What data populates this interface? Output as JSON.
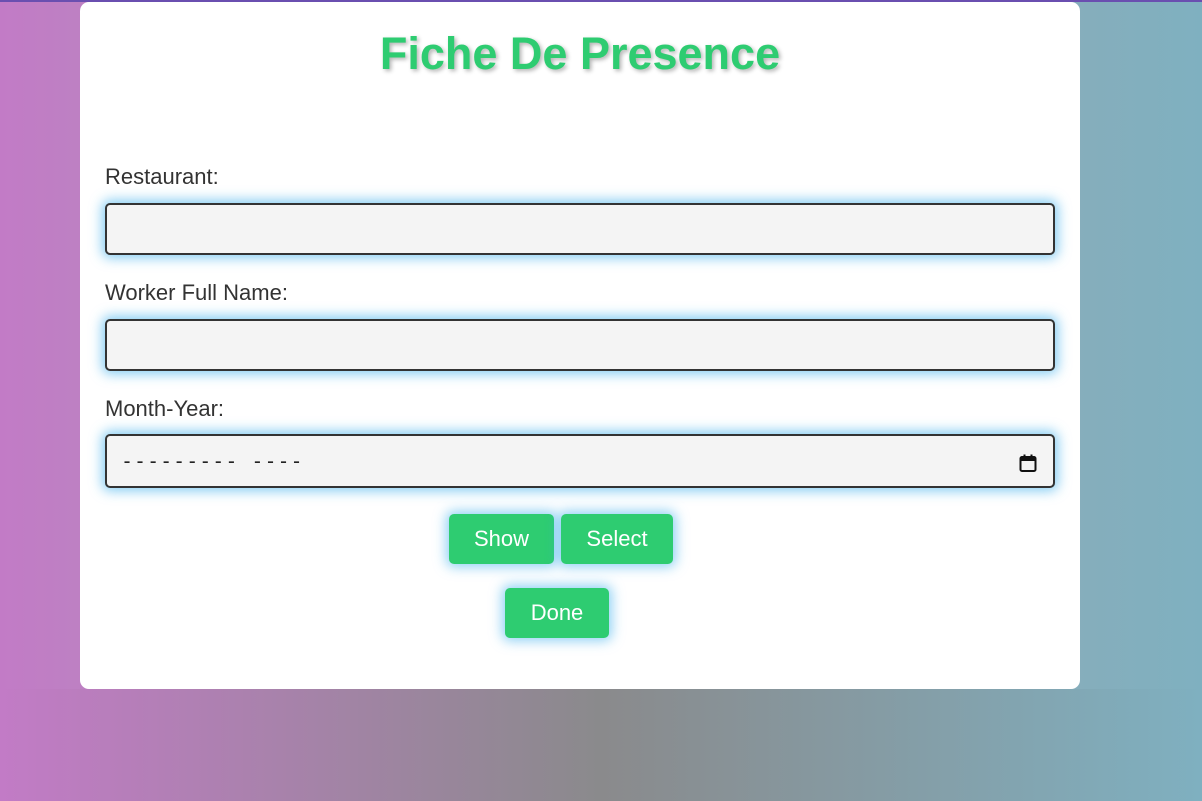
{
  "page": {
    "title": "Fiche De Presence"
  },
  "form": {
    "restaurant_label": "Restaurant:",
    "restaurant_value": "",
    "worker_label": "Worker Full Name:",
    "worker_value": "",
    "month_year_label": "Month-Year:",
    "month_year_display": "--------- ----"
  },
  "buttons": {
    "show_label": "Show",
    "select_label": "Select",
    "done_label": "Done"
  },
  "icons": {
    "calendar": "calendar-icon"
  },
  "colors": {
    "accent": "#2ecc71",
    "glow": "#34acef",
    "background_left": "#c27bc6",
    "background_right": "#7fb0c0"
  }
}
